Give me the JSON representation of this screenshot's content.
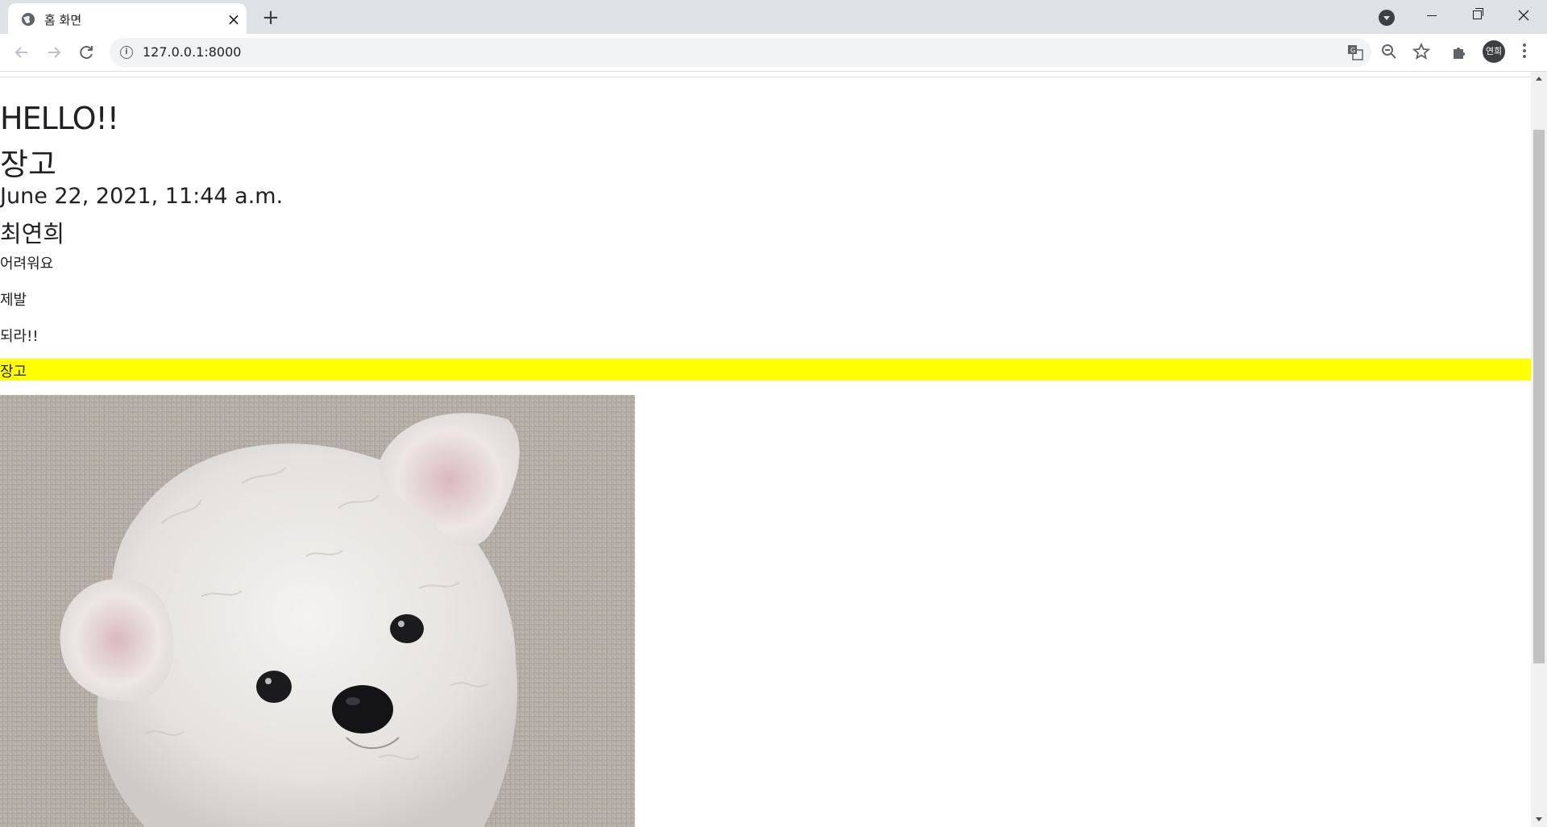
{
  "browser": {
    "tab": {
      "title": "홈 화면",
      "close_glyph": "×",
      "favicon_icon": "globe-icon"
    },
    "new_tab_glyph": "+",
    "address": {
      "url": "127.0.0.1:8000",
      "info_glyph": "i"
    },
    "profile": {
      "avatar_label": "연희"
    },
    "icons": [
      "back-icon",
      "forward-icon",
      "reload-icon",
      "translate-icon",
      "zoom-icon",
      "bookmark-star-icon",
      "extensions-icon",
      "menu-icon"
    ]
  },
  "page": {
    "heading": "HELLO!!",
    "title": "장고",
    "date": "June 22, 2021, 11:44 a.m.",
    "author": "최연희",
    "paragraphs": [
      "어려워요",
      "제발",
      "되라!!"
    ],
    "highlight_text": "장고",
    "highlight_color": "#ffff00"
  }
}
